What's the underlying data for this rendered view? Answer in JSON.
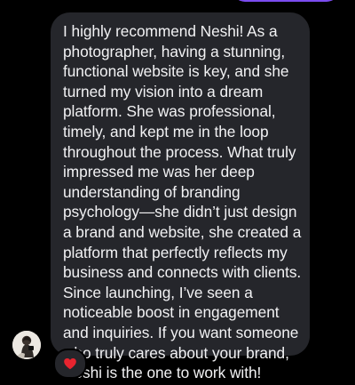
{
  "thread": {
    "message": {
      "lines": [
        "I highly recommend Neshi! As a",
        "photographer, having a stunning,",
        "functional website is key, and she",
        "turned my vision into a dream",
        "platform. She was professional,",
        "timely, and kept me in the loop",
        "throughout the process. What truly",
        "impressed me was her deep",
        "understanding of branding",
        "psychology—she didn’t just design",
        "a brand and website, she created a",
        "platform that perfectly reflects my",
        "business and connects with clients.",
        "Since launching, I’ve seen a",
        "noticeable boost in engagement",
        "and inquiries. If you want someone",
        "who truly cares about your brand,",
        "Neshi is the one to work with!"
      ],
      "reaction": "heart-icon"
    },
    "sender": {
      "avatar": "profile-photo"
    }
  },
  "colors": {
    "background": "#000000",
    "bubble": "#25262b",
    "text": "#f2f2f4",
    "outgoing_bubble": "#7b4cf0",
    "heart": "#e8242f"
  }
}
